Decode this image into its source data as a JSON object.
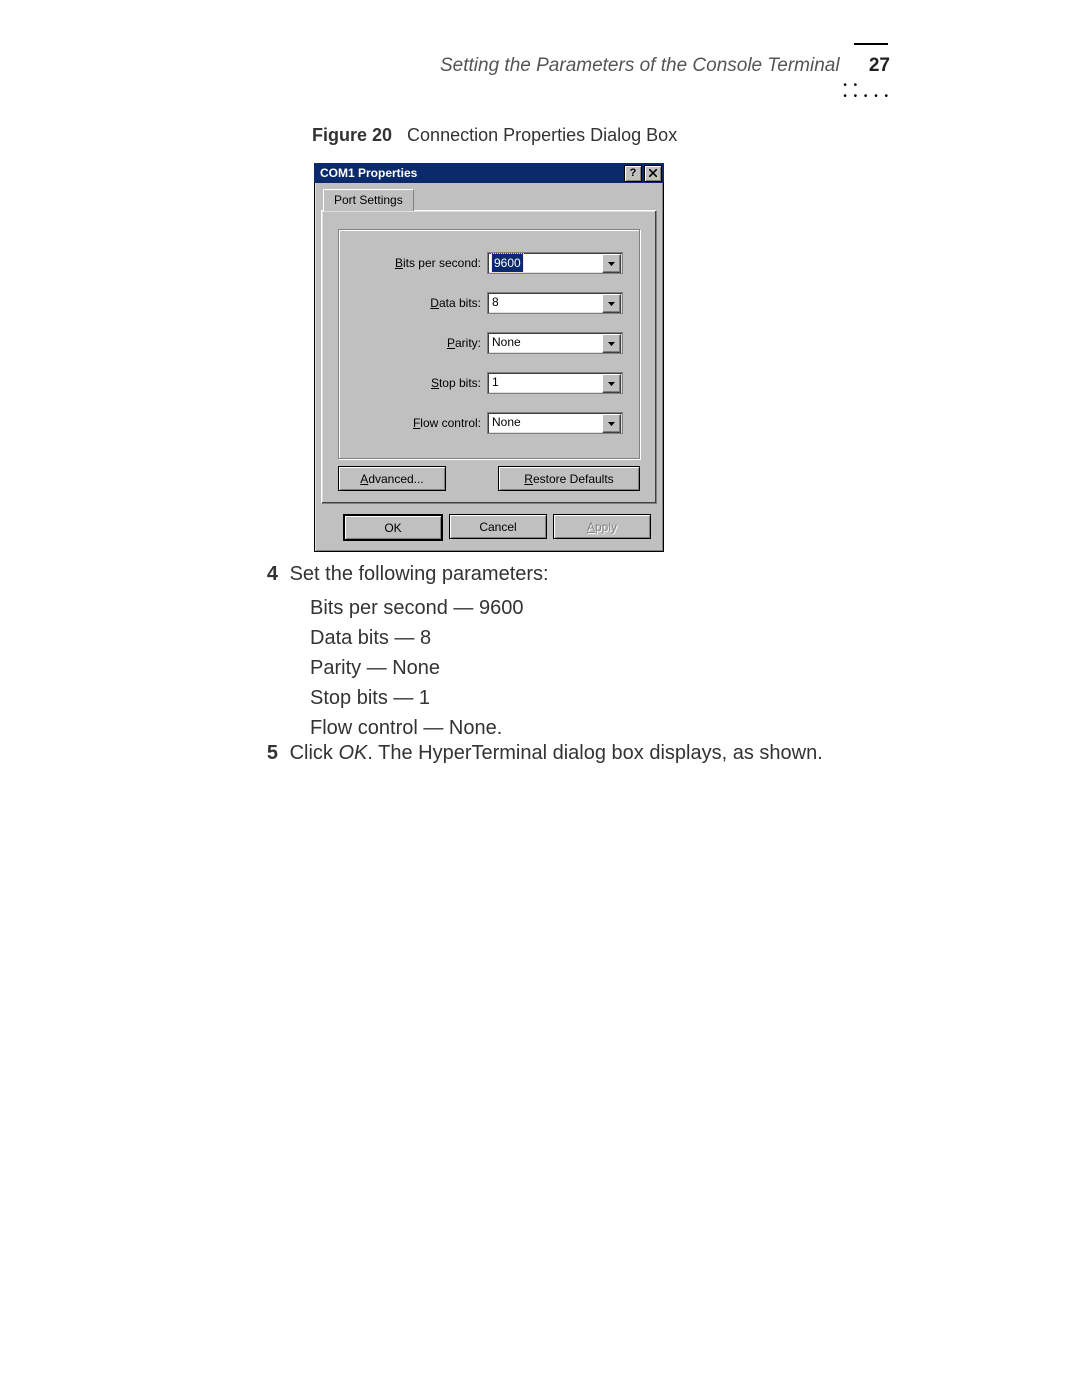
{
  "header": {
    "running_title": "Setting the Parameters of the Console Terminal",
    "page_number": "27"
  },
  "caption": {
    "label": "Figure 20",
    "text": "Connection Properties Dialog Box"
  },
  "dialog": {
    "title": "COM1 Properties",
    "help_btn": "?",
    "tab_label": "Port Settings",
    "fields": {
      "bps": {
        "label_pre": "B",
        "label_rest": "its per second:",
        "value": "9600"
      },
      "databits": {
        "label_pre": "D",
        "label_rest": "ata bits:",
        "value": "8"
      },
      "parity": {
        "label_pre": "P",
        "label_rest": "arity:",
        "value": "None"
      },
      "stopbits": {
        "label_pre": "S",
        "label_rest": "top bits:",
        "value": "1"
      },
      "flow": {
        "label_pre": "F",
        "label_rest": "low control:",
        "value": "None"
      }
    },
    "buttons": {
      "advanced_pre": "A",
      "advanced_rest": "dvanced...",
      "restore_pre": "R",
      "restore_rest": "estore Defaults",
      "ok": "OK",
      "cancel": "Cancel",
      "apply_pre": "A",
      "apply_rest": "pply"
    }
  },
  "steps": {
    "s4_num": "4",
    "s4_text": "Set the following parameters:",
    "params": [
      "Bits per second — 9600",
      "Data bits — 8",
      "Parity — None",
      "Stop bits — 1",
      "Flow control — None."
    ],
    "s5_num": "5",
    "s5_pre": "Click ",
    "s5_ok": "OK",
    "s5_post": ". The HyperTerminal dialog box displays, as shown."
  }
}
